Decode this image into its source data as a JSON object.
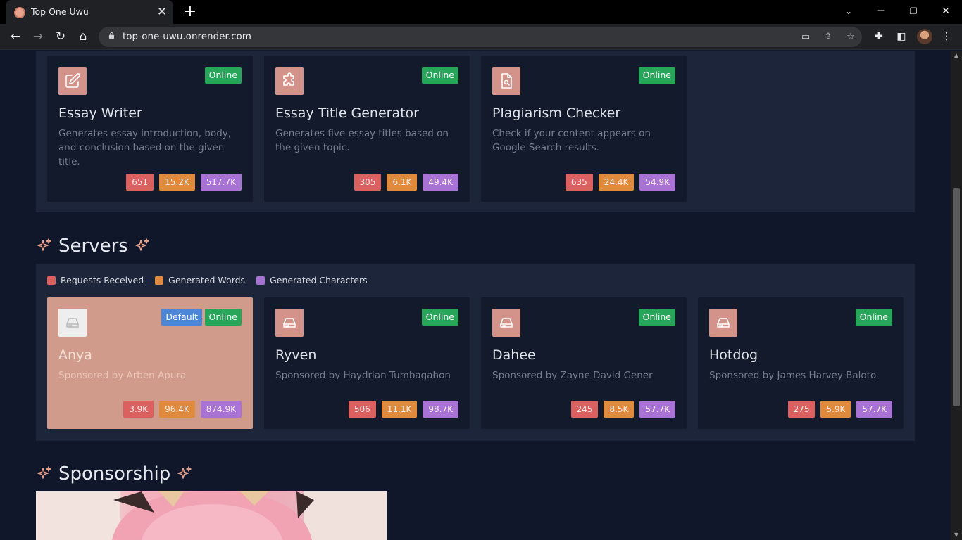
{
  "browser": {
    "tab_title": "Top One Uwu",
    "url": "top-one-uwu.onrender.com"
  },
  "tools": [
    {
      "title": "Essay Writer",
      "status": "Online",
      "icon": "edit-icon",
      "description": "Generates essay introduction, body, and conclusion based on the given title.",
      "stats": [
        "651",
        "15.2K",
        "517.7K"
      ]
    },
    {
      "title": "Essay Title Generator",
      "status": "Online",
      "icon": "puzzle-icon",
      "description": "Generates five essay titles based on the given topic.",
      "stats": [
        "305",
        "6.1K",
        "49.4K"
      ]
    },
    {
      "title": "Plagiarism Checker",
      "status": "Online",
      "icon": "file-search-icon",
      "description": "Check if your content appears on Google Search results.",
      "stats": [
        "635",
        "24.4K",
        "54.9K"
      ]
    }
  ],
  "servers_section": {
    "title": "Servers",
    "legend": [
      "Requests Received",
      "Generated Words",
      "Generated Characters"
    ],
    "servers": [
      {
        "name": "Anya",
        "default_badge": "Default",
        "status": "Online",
        "icon": "hard-drive-icon",
        "sponsor": "Sponsored by Arben Apura",
        "stats": [
          "3.9K",
          "96.4K",
          "874.9K"
        ]
      },
      {
        "name": "Ryven",
        "status": "Online",
        "icon": "hard-drive-icon",
        "sponsor": "Sponsored by Haydrian Tumbagahon",
        "stats": [
          "506",
          "11.1K",
          "98.7K"
        ]
      },
      {
        "name": "Dahee",
        "status": "Online",
        "icon": "hard-drive-icon",
        "sponsor": "Sponsored by Zayne David Gener",
        "stats": [
          "245",
          "8.5K",
          "57.7K"
        ]
      },
      {
        "name": "Hotdog",
        "status": "Online",
        "icon": "hard-drive-icon",
        "sponsor": "Sponsored by James Harvey Baloto",
        "stats": [
          "275",
          "5.9K",
          "57.7K"
        ]
      }
    ]
  },
  "sponsorship_section": {
    "title": "Sponsorship"
  },
  "colors": {
    "page_bg": "#11172a",
    "panel_bg": "#1c2539",
    "card_bg": "#121a2c",
    "accent_salmon": "#d4938a",
    "online_green": "#27a65a",
    "default_blue": "#4b86d9",
    "stat_red": "#db6060",
    "stat_orange": "#df8a3c",
    "stat_purple": "#a973d6"
  }
}
